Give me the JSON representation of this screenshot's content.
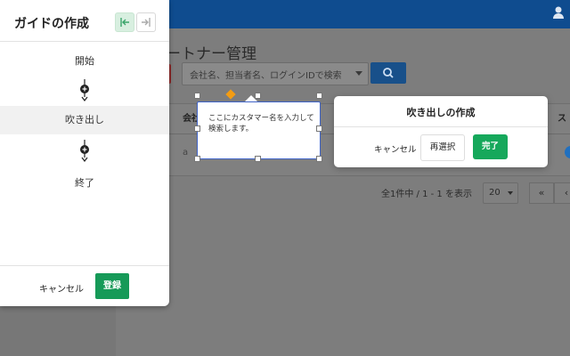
{
  "background_app": {
    "page_title": "ートナー管理",
    "search": {
      "placeholder": "会社名、担当者名、ログインIDで検索"
    },
    "table": {
      "header_left": "会社",
      "header_right": "ス",
      "row_cell": "a"
    },
    "pagination": {
      "summary": "全1件中 / 1 - 1 を表示",
      "page_size": "20",
      "first": "«",
      "prev": "‹"
    }
  },
  "guide_panel": {
    "title": "ガイドの作成",
    "steps": [
      {
        "label": "開始"
      },
      {
        "label": "吹き出し"
      },
      {
        "label": "終了"
      }
    ],
    "cancel_label": "キャンセル",
    "register_label": "登録"
  },
  "bubble": {
    "text": "ここにカスタマー名を入力して検索します。"
  },
  "create_modal": {
    "title": "吹き出しの作成",
    "cancel_label": "キャンセル",
    "reselect_label": "再選択",
    "done_label": "完了"
  },
  "colors": {
    "topbar": "#0f4c8f",
    "primary_green": "#16a85b",
    "bubble_border": "#3f63c7"
  }
}
